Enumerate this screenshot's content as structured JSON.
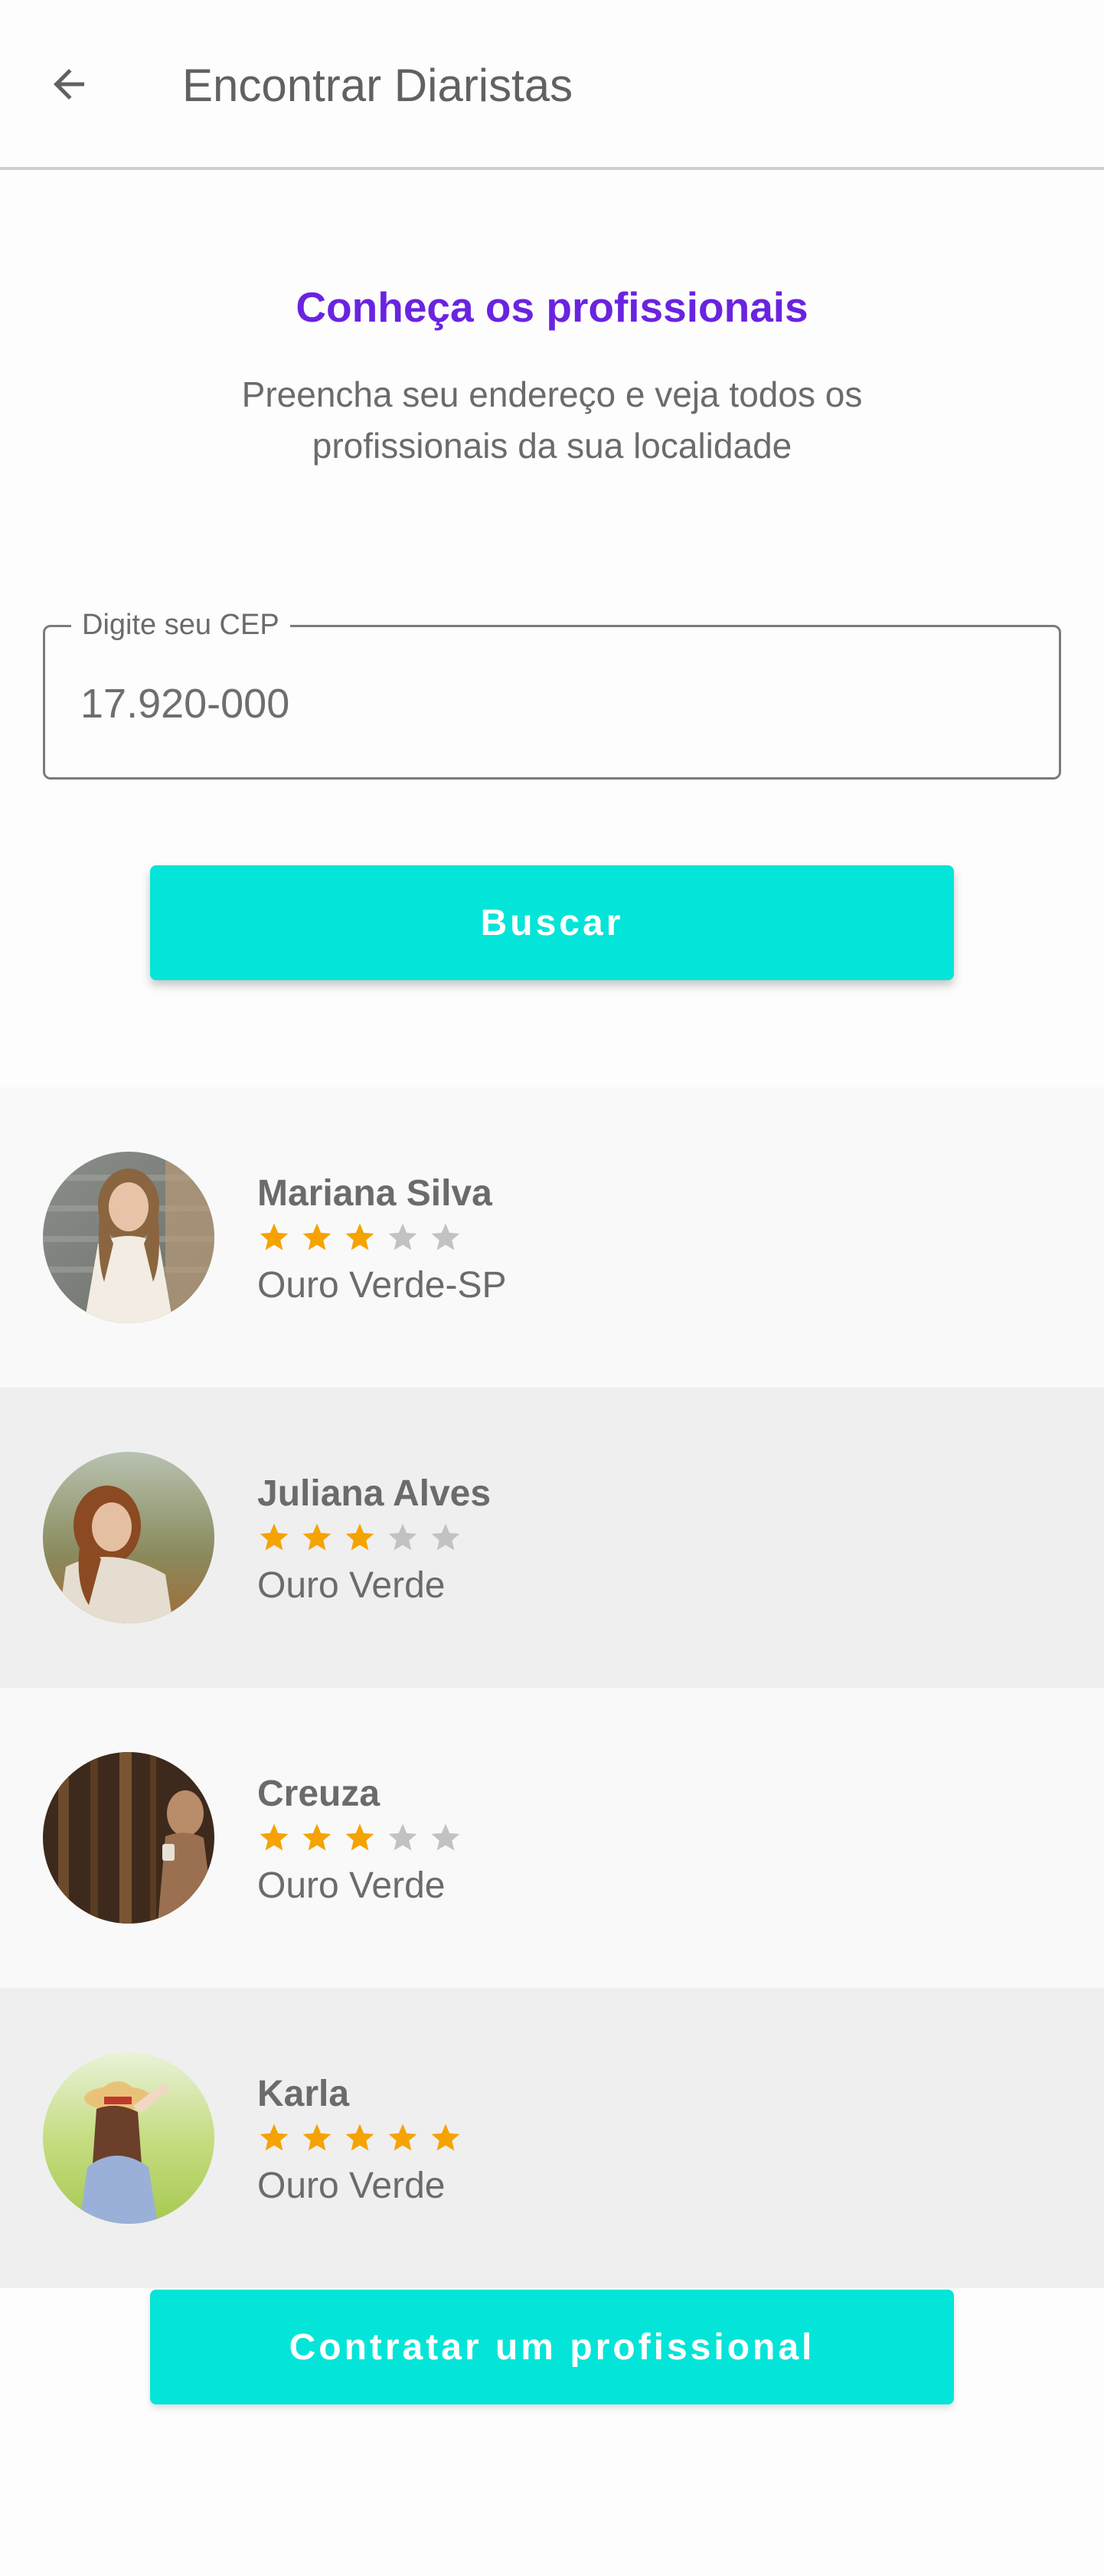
{
  "appbar": {
    "title": "Encontrar Diaristas",
    "back_icon": "arrow-left-icon"
  },
  "intro": {
    "headline": "Conheça os profissionais",
    "subtitle": "Preencha seu endereço e veja todos os profissionais da sua localidade"
  },
  "cep": {
    "label": "Digite seu CEP",
    "value": "17.920-000"
  },
  "search_button": {
    "label": "Buscar"
  },
  "professionals": [
    {
      "name": "Mariana Silva",
      "rating": 3,
      "max_rating": 5,
      "city": "Ouro Verde-SP"
    },
    {
      "name": "Juliana Alves",
      "rating": 3,
      "max_rating": 5,
      "city": "Ouro Verde"
    },
    {
      "name": "Creuza",
      "rating": 3,
      "max_rating": 5,
      "city": "Ouro Verde"
    },
    {
      "name": "Karla",
      "rating": 5,
      "max_rating": 5,
      "city": "Ouro Verde"
    }
  ],
  "hire_button": {
    "label": "Contratar um profissional"
  },
  "colors": {
    "accent": "#03e5d8",
    "headline": "#6a23e0",
    "star_filled": "#f5a300",
    "star_empty": "#c2c2c2",
    "text": "#6b6b6b"
  }
}
